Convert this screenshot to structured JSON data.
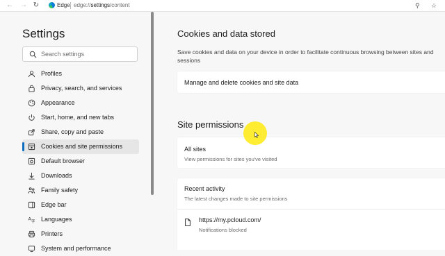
{
  "browser": {
    "brand": "Edge",
    "url_prefix": "edge://",
    "url_path": "settings",
    "url_suffix": "/content"
  },
  "sidebar": {
    "title": "Settings",
    "search_placeholder": "Search settings",
    "items": [
      {
        "label": "Profiles",
        "icon": "profile-icon"
      },
      {
        "label": "Privacy, search, and services",
        "icon": "lock-icon"
      },
      {
        "label": "Appearance",
        "icon": "appearance-icon"
      },
      {
        "label": "Start, home, and new tabs",
        "icon": "power-icon"
      },
      {
        "label": "Share, copy and paste",
        "icon": "share-icon"
      },
      {
        "label": "Cookies and site permissions",
        "icon": "cookies-icon",
        "active": true
      },
      {
        "label": "Default browser",
        "icon": "browser-icon"
      },
      {
        "label": "Downloads",
        "icon": "download-icon"
      },
      {
        "label": "Family safety",
        "icon": "family-icon"
      },
      {
        "label": "Edge bar",
        "icon": "edge-bar-icon"
      },
      {
        "label": "Languages",
        "icon": "languages-icon"
      },
      {
        "label": "Printers",
        "icon": "printer-icon"
      },
      {
        "label": "System and performance",
        "icon": "system-icon"
      }
    ]
  },
  "main": {
    "cookies_section": {
      "title": "Cookies and data stored",
      "description": "Save cookies and data on your device in order to facilitate continuous browsing between sites and sessions",
      "manage_label": "Manage and delete cookies and site data"
    },
    "permissions_section": {
      "title": "Site permissions",
      "all_sites_title": "All sites",
      "all_sites_sub": "View permissions for sites you've visited",
      "recent_title": "Recent activity",
      "recent_sub": "The latest changes made to site permissions",
      "recent_items": [
        {
          "site": "https://my.pcloud.com/",
          "detail": "Notifications blocked"
        }
      ]
    }
  },
  "colors": {
    "accent": "#0f6cbd",
    "highlight": "#ffe800"
  }
}
